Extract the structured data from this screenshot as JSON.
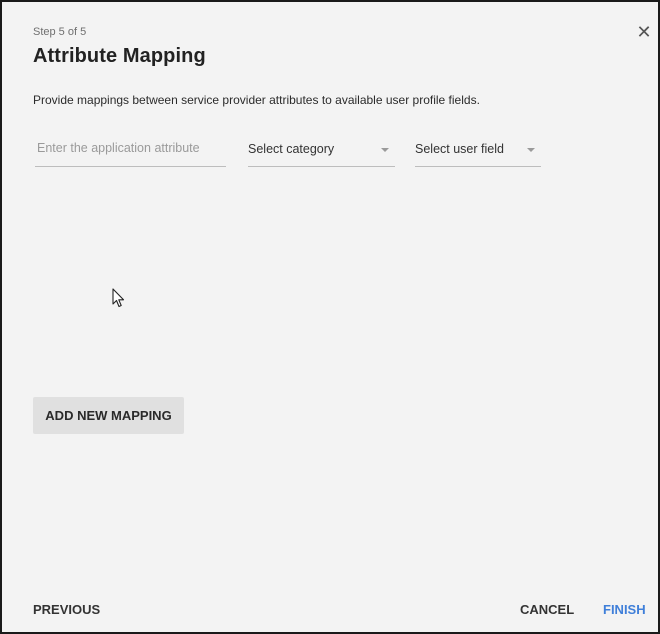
{
  "dialog": {
    "step_text": "Step 5 of 5",
    "title": "Attribute Mapping",
    "close_glyph": "✕",
    "description": "Provide mappings between service provider attributes to available user profile fields."
  },
  "mapping_row": {
    "attribute_input": {
      "value": "",
      "placeholder": "Enter the application attribute"
    },
    "category_select": {
      "selected": "Select category"
    },
    "user_field_select": {
      "selected": "Select user field"
    }
  },
  "actions": {
    "add_mapping_label": "ADD NEW MAPPING",
    "previous_label": "PREVIOUS",
    "cancel_label": "CANCEL",
    "finish_label": "FINISH"
  },
  "icons": {
    "close": "close-icon",
    "dropdown": "chevron-down-icon",
    "cursor": "mouse-pointer-icon"
  },
  "colors": {
    "primary": "#3f7fd9",
    "dialog_background": "#f3f3f3",
    "secondary_button": "#e0e0e0"
  }
}
